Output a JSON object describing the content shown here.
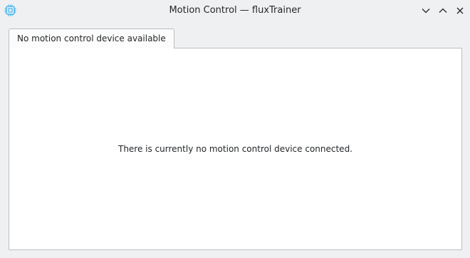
{
  "window": {
    "title": "Motion Control — fluxTrainer",
    "app_icon": "chip-icon",
    "controls": {
      "minimize_icon": "chevron-down-icon",
      "maximize_icon": "chevron-up-icon",
      "close_icon": "close-icon"
    }
  },
  "tabs": [
    {
      "label": "No motion control device available",
      "active": true
    }
  ],
  "main": {
    "message": "There is currently no motion control device connected."
  },
  "colors": {
    "background": "#eff0f1",
    "panel": "#ffffff",
    "border": "#bcbebf",
    "accent": "#3daee9",
    "text": "#232629"
  }
}
